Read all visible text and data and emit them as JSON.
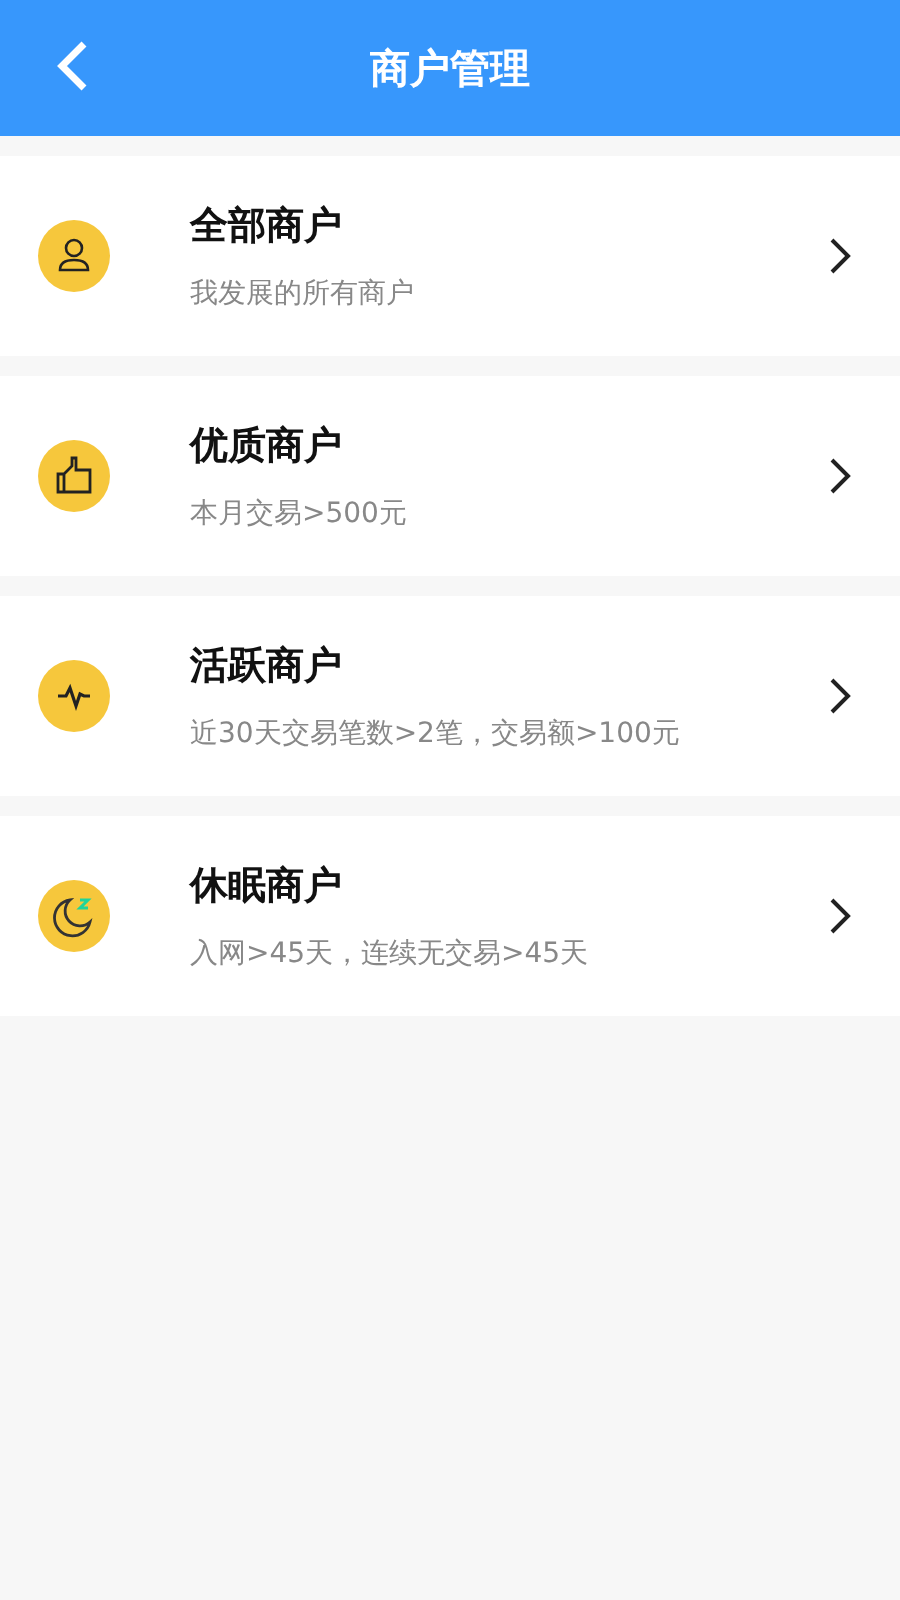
{
  "header": {
    "title": "商户管理"
  },
  "items": [
    {
      "kind": "person",
      "title": "全部商户",
      "subtitle": "我发展的所有商户"
    },
    {
      "kind": "thumb",
      "title": "优质商户",
      "subtitle": "本月交易>500元"
    },
    {
      "kind": "pulse",
      "title": "活跃商户",
      "subtitle": "近30天交易笔数>2笔，交易额>100元"
    },
    {
      "kind": "moon",
      "title": "休眠商户",
      "subtitle": "入网>45天，连续无交易>45天"
    }
  ]
}
